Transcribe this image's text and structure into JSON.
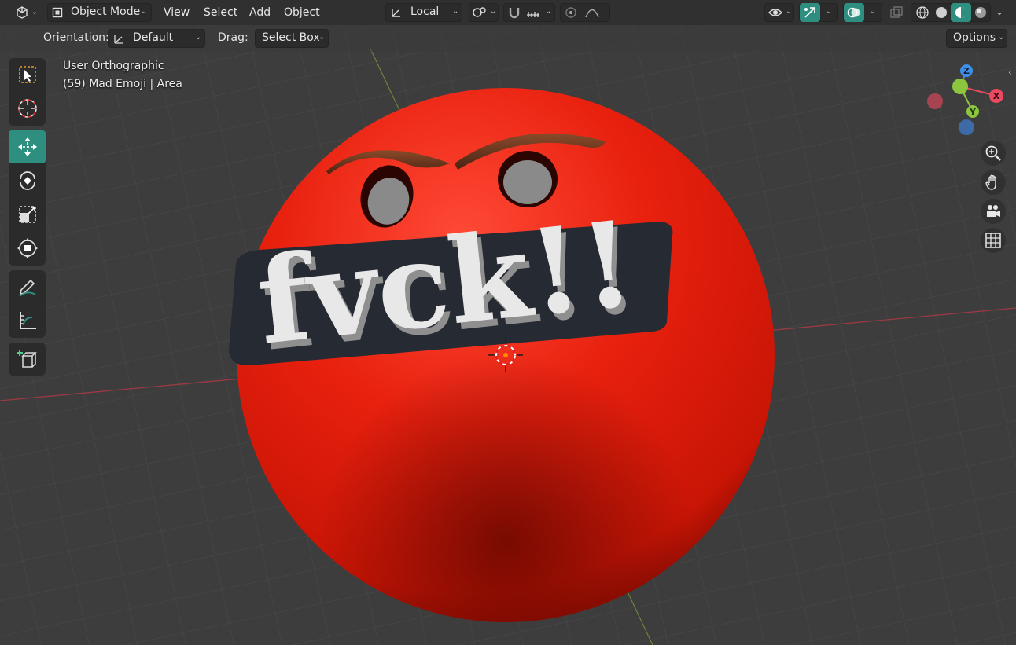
{
  "header": {
    "mode": "Object Mode",
    "menus": [
      "View",
      "Select",
      "Add",
      "Object"
    ],
    "transform_orientation": "Local"
  },
  "tool_settings": {
    "orientation_label": "Orientation:",
    "orientation_value": "Default",
    "drag_label": "Drag:",
    "drag_value": "Select Box",
    "options_label": "Options"
  },
  "viewport": {
    "view_name": "User Orthographic",
    "object_info": "(59) Mad Emoji | Area",
    "scene_text": "fvck!!"
  },
  "gizmo": {
    "x": "X",
    "y": "Y",
    "z": "Z"
  },
  "toolbar": {
    "tools": [
      "select-box",
      "cursor",
      "move",
      "rotate",
      "scale",
      "transform",
      "annotate",
      "measure",
      "add-cube"
    ],
    "active": "move"
  },
  "colors": {
    "accent": "#2e8f80",
    "emoji_red": "#e02010",
    "axis_x": "#e84a5f",
    "axis_y": "#8cc63f",
    "axis_z": "#3d8fe8"
  }
}
